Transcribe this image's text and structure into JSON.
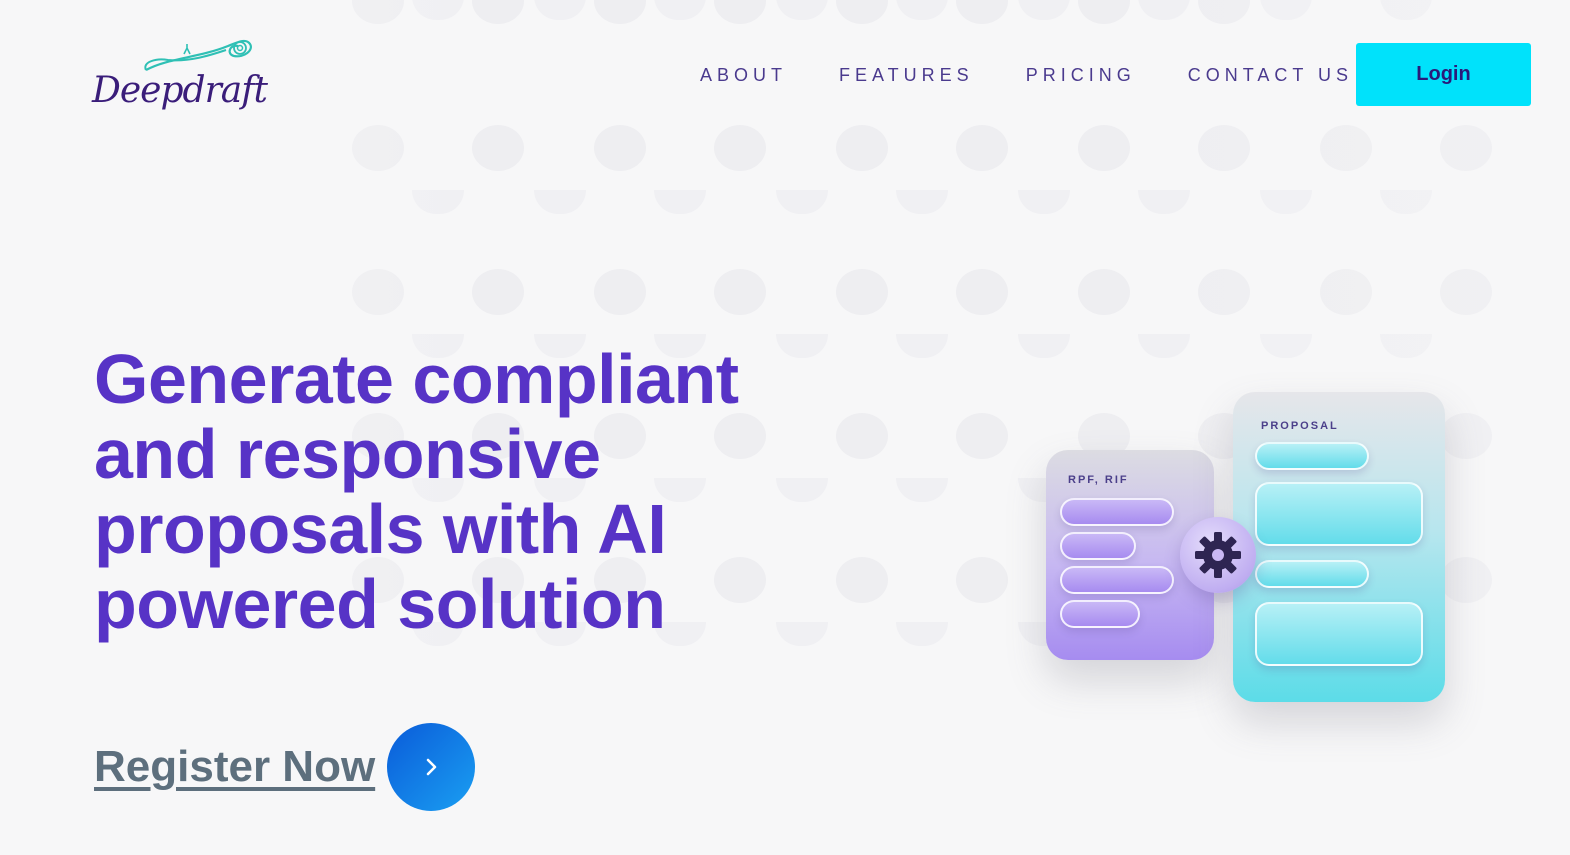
{
  "brand": {
    "logo_text": "Deepdraft",
    "logo_icon": "scroll-icon",
    "colors": {
      "primary": "#5733c6",
      "accent": "#00e2fb",
      "logo": "#3a1d7a"
    }
  },
  "nav": {
    "items": [
      {
        "label": "ABOUT"
      },
      {
        "label": "FEATURES"
      },
      {
        "label": "PRICING"
      },
      {
        "label": "CONTACT US"
      }
    ],
    "login_label": "Login"
  },
  "hero": {
    "title": "Generate compliant and responsive proposals with AI powered solution",
    "cta_label": "Register Now",
    "cta_icon": "chevron-right-icon"
  },
  "illustration": {
    "left_card_label": "RPF, RIF",
    "right_card_label": "PROPOSAL",
    "center_icon": "gear-icon"
  }
}
